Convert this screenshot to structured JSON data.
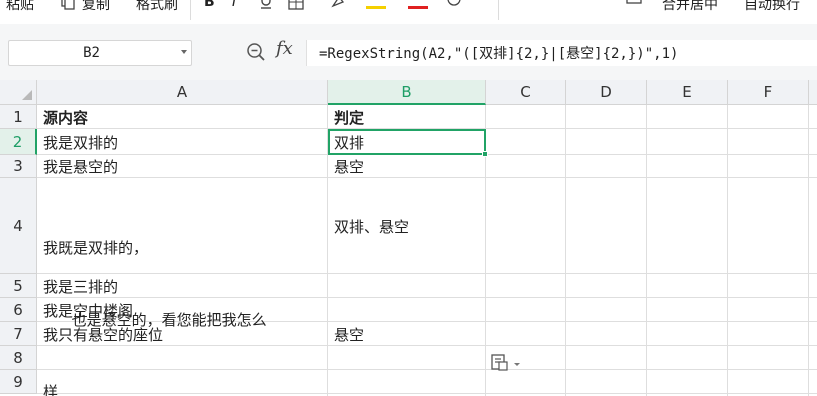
{
  "ribbon": {
    "paste_label": "粘贴",
    "copy_label": "复制",
    "format_painter_label": "格式刷",
    "merge_center_label": "合并居中",
    "wrap_text_label": "自动换行",
    "icons": [
      "copy-icon",
      "bold-icon",
      "italic-icon",
      "underline-icon",
      "border-icon",
      "fill-color-icon",
      "font-color-icon",
      "clear-icon",
      "align-icon",
      "merge-icon"
    ]
  },
  "formula_bar": {
    "name_box": "B2",
    "fx_label": "fx",
    "formula": "=RegexString(A2,\"([双排]{2,}|[悬空]{2,})\",1)"
  },
  "columns": [
    "A",
    "B",
    "C",
    "D",
    "E",
    "F"
  ],
  "selected_column": "B",
  "rows": [
    "1",
    "2",
    "3",
    "4",
    "5",
    "6",
    "7",
    "8",
    "9"
  ],
  "selected_row": "2",
  "cells": {
    "A1": "源内容",
    "B1": "判定",
    "A2": "我是双排的",
    "B2": "双排",
    "A3": "我是悬空的",
    "B3": "悬空",
    "A4_line1": "我既是双排的，",
    "A4_line2": "      也是悬空的，看您能把我怎么",
    "A4_line3": "样",
    "B4": "双排、悬空",
    "A5": "我是三排的",
    "A6": "我是空中楼阁",
    "A7": "我只有悬空的座位",
    "B7": "悬空"
  },
  "colors": {
    "accent": "#21a366",
    "header_bg": "#f0f2f5",
    "grid_line": "#dedede"
  }
}
